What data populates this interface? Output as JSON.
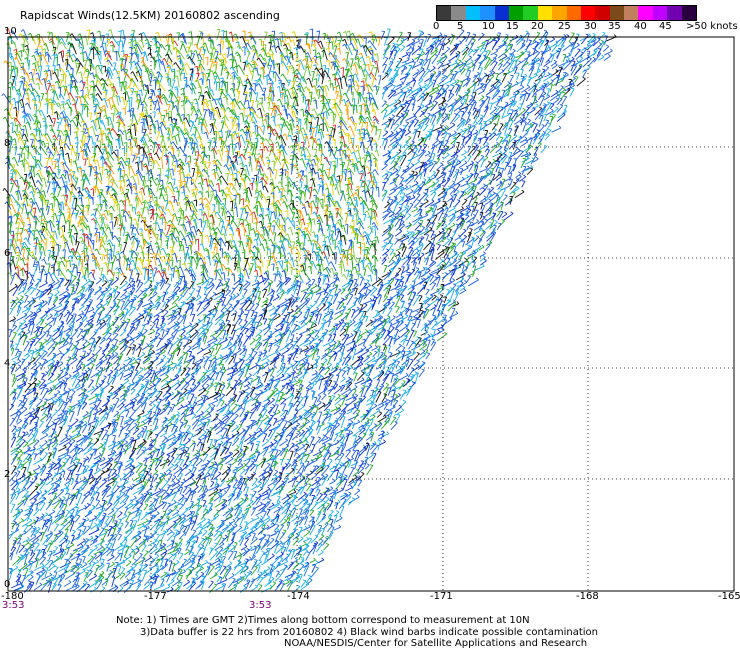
{
  "title": "Rapidscat Winds(12.5KM) 20160802 ascending",
  "legend": {
    "labels": [
      "0",
      "5",
      "10",
      "15",
      "20",
      "25",
      "30",
      "35",
      "40",
      "45",
      ">50 knots"
    ],
    "colors": [
      "#3a3a3a",
      "#8a8a8a",
      "#00bfff",
      "#1e90ff",
      "#0a2fd0",
      "#00a000",
      "#22cc22",
      "#ffe000",
      "#ffa500",
      "#ff6a00",
      "#ff0000",
      "#d00000",
      "#7a4a1a",
      "#c08060",
      "#ff00ff",
      "#c000ff",
      "#7000b0",
      "#2a0040"
    ]
  },
  "x_ticks": [
    "-180",
    "-177",
    "-174",
    "-171",
    "-168",
    "-165"
  ],
  "y_ticks": [
    "10",
    "8",
    "6",
    "4",
    "2",
    "0"
  ],
  "times": [
    "3:53",
    "3:53"
  ],
  "notes": [
    "Note: 1) Times are GMT 2)Times along bottom correspond to measurement at 10N",
    "3)Data buffer is 22 hrs from 20160802 4) Black wind barbs indicate possible contamination",
    "NOAA/NESDIS/Center for Satellite Applications and Research"
  ]
}
